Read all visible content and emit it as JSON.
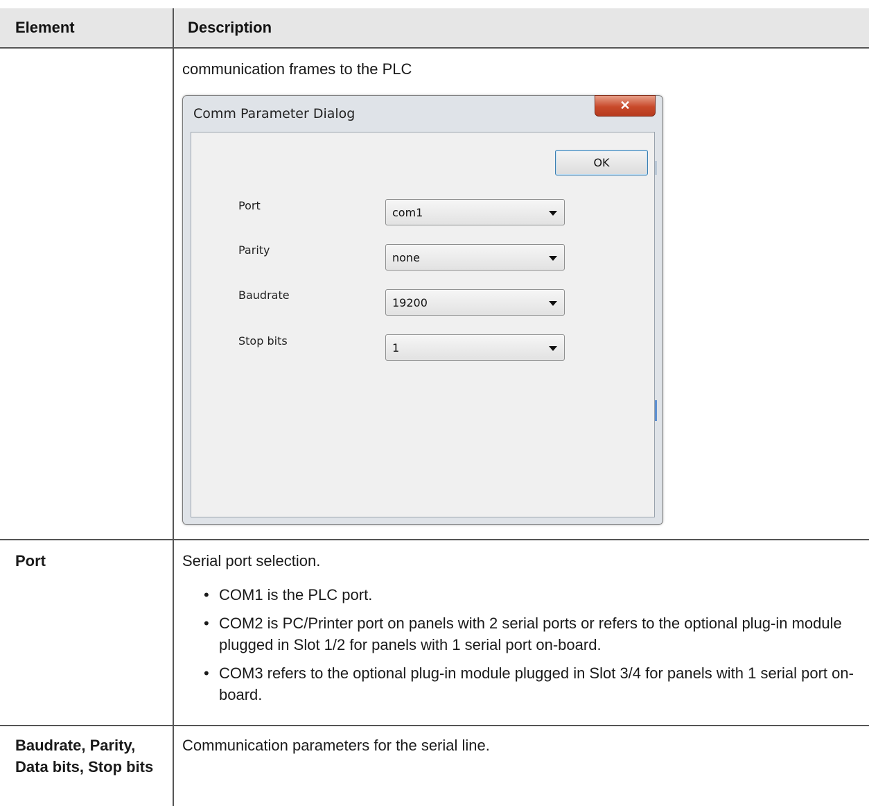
{
  "table": {
    "header": {
      "element": "Element",
      "description": "Description"
    },
    "row0": {
      "description": "communication frames to the PLC"
    },
    "row1": {
      "element": "Port",
      "description": "Serial port selection.",
      "bullets": [
        "COM1 is the PLC port.",
        "COM2 is PC/Printer port on panels with 2 serial ports or refers to the optional plug-in module plugged in Slot 1/2 for panels with 1 serial port on-board.",
        "COM3 refers to the optional plug-in module plugged in Slot 3/4 for panels with 1 serial port on-board."
      ]
    },
    "row2": {
      "element": "Baudrate, Parity, Data bits, Stop bits",
      "description": "Communication parameters for the serial line."
    }
  },
  "dialog": {
    "title": "Comm Parameter Dialog",
    "ok_label": "OK",
    "close_icon": "close-x-icon",
    "fields": [
      {
        "label": "Port",
        "value": "com1"
      },
      {
        "label": "Parity",
        "value": "none"
      },
      {
        "label": "Baudrate",
        "value": "19200"
      },
      {
        "label": "Stop bits",
        "value": "1"
      }
    ]
  },
  "colors": {
    "header_bg": "#e6e6e6",
    "rule": "#555555",
    "close_button": "#c84a2b",
    "ok_focus": "#3c7fb1"
  }
}
